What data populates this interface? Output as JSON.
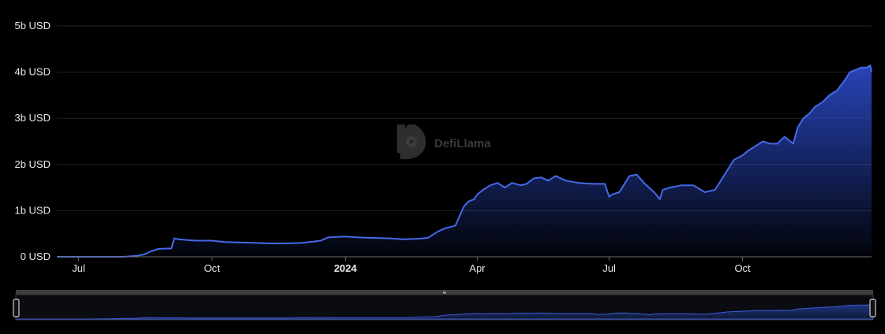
{
  "chart_data": {
    "type": "area",
    "title": "",
    "xlabel": "",
    "ylabel": "",
    "unit": "USD",
    "ylim": [
      0,
      5
    ],
    "y_ticks": [
      "0 USD",
      "1b USD",
      "2b USD",
      "3b USD",
      "4b USD",
      "5b USD"
    ],
    "x_ticks": [
      {
        "label": "Jul",
        "date": "2023-07-01",
        "bold": false
      },
      {
        "label": "Oct",
        "date": "2023-10-01",
        "bold": false
      },
      {
        "label": "2024",
        "date": "2024-01-01",
        "bold": true
      },
      {
        "label": "Apr",
        "date": "2024-04-01",
        "bold": false
      },
      {
        "label": "Jul",
        "date": "2024-07-01",
        "bold": false
      },
      {
        "label": "Oct",
        "date": "2024-10-01",
        "bold": false
      }
    ],
    "x_range": [
      "2023-06-16",
      "2024-12-29"
    ],
    "grid": true,
    "line_color": "#4569e8",
    "area_color": "#2c4ccc",
    "series": [
      {
        "x": [
          "2023-06-16",
          "2023-07-01",
          "2023-08-01",
          "2023-08-10",
          "2023-08-15",
          "2023-08-20",
          "2023-08-25",
          "2023-08-30",
          "2023-09-03",
          "2023-09-05",
          "2023-09-08",
          "2023-09-15",
          "2023-09-20",
          "2023-10-01",
          "2023-10-10",
          "2023-10-20",
          "2023-11-01",
          "2023-11-10",
          "2023-11-20",
          "2023-12-01",
          "2023-12-10",
          "2023-12-15",
          "2023-12-20",
          "2024-01-01",
          "2024-01-10",
          "2024-01-20",
          "2024-02-01",
          "2024-02-10",
          "2024-02-20",
          "2024-02-27",
          "2024-03-05",
          "2024-03-10",
          "2024-03-14",
          "2024-03-17",
          "2024-03-20",
          "2024-03-23",
          "2024-03-26",
          "2024-03-30",
          "2024-04-01",
          "2024-04-05",
          "2024-04-10",
          "2024-04-15",
          "2024-04-20",
          "2024-04-25",
          "2024-05-01",
          "2024-05-05",
          "2024-05-10",
          "2024-05-15",
          "2024-05-20",
          "2024-05-25",
          "2024-06-01",
          "2024-06-10",
          "2024-06-20",
          "2024-06-28",
          "2024-07-01",
          "2024-07-03",
          "2024-07-08",
          "2024-07-12",
          "2024-07-15",
          "2024-07-20",
          "2024-07-25",
          "2024-08-01",
          "2024-08-05",
          "2024-08-07",
          "2024-08-12",
          "2024-08-20",
          "2024-08-28",
          "2024-09-05",
          "2024-09-12",
          "2024-09-15",
          "2024-09-20",
          "2024-09-25",
          "2024-10-01",
          "2024-10-05",
          "2024-10-10",
          "2024-10-15",
          "2024-10-20",
          "2024-10-25",
          "2024-10-30",
          "2024-11-05",
          "2024-11-08",
          "2024-11-12",
          "2024-11-16",
          "2024-11-20",
          "2024-11-25",
          "2024-11-30",
          "2024-12-05",
          "2024-12-10",
          "2024-12-14",
          "2024-12-18",
          "2024-12-22",
          "2024-12-26",
          "2024-12-28",
          "2024-12-29"
        ],
        "values": [
          0,
          0,
          0,
          0.02,
          0.05,
          0.12,
          0.17,
          0.18,
          0.18,
          0.4,
          0.38,
          0.36,
          0.35,
          0.35,
          0.32,
          0.31,
          0.3,
          0.29,
          0.29,
          0.3,
          0.33,
          0.35,
          0.42,
          0.44,
          0.42,
          0.41,
          0.4,
          0.38,
          0.39,
          0.41,
          0.55,
          0.62,
          0.65,
          0.68,
          0.9,
          1.1,
          1.2,
          1.25,
          1.35,
          1.45,
          1.55,
          1.6,
          1.5,
          1.6,
          1.55,
          1.58,
          1.7,
          1.72,
          1.65,
          1.75,
          1.65,
          1.6,
          1.58,
          1.58,
          1.3,
          1.35,
          1.4,
          1.6,
          1.75,
          1.78,
          1.6,
          1.4,
          1.25,
          1.45,
          1.5,
          1.55,
          1.55,
          1.4,
          1.45,
          1.6,
          1.85,
          2.1,
          2.2,
          2.3,
          2.4,
          2.5,
          2.45,
          2.45,
          2.6,
          2.45,
          2.8,
          3.0,
          3.1,
          3.25,
          3.35,
          3.5,
          3.6,
          3.8,
          4.0,
          4.05,
          4.1,
          4.1,
          4.15,
          4.0
        ]
      }
    ]
  },
  "watermark": {
    "text": "DefiLlama"
  },
  "range_slider": {
    "handle_grip": "≡"
  }
}
